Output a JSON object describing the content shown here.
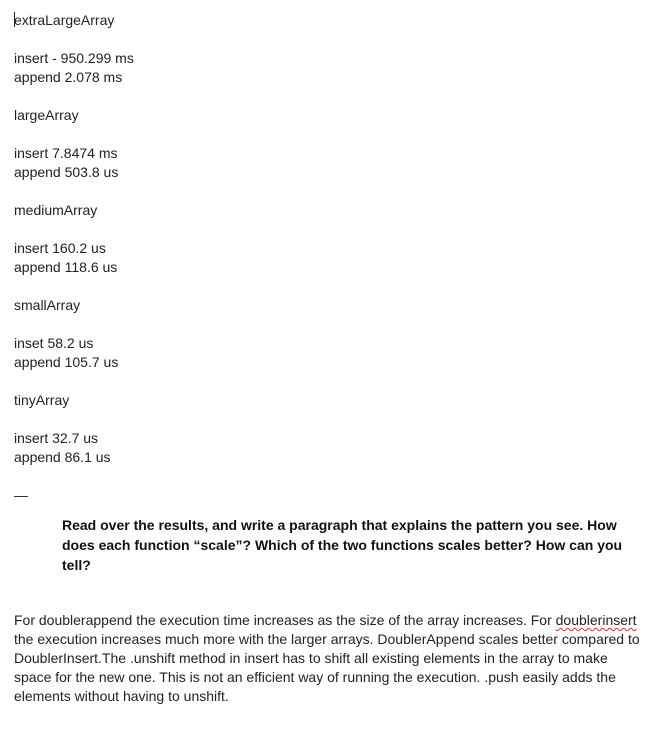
{
  "sections": [
    {
      "name": "extraLargeArray",
      "insert": "insert - 950.299 ms",
      "append": "append 2.078 ms"
    },
    {
      "name": "largeArray",
      "insert": "insert 7.8474 ms",
      "append": "append 503.8 us"
    },
    {
      "name": "mediumArray",
      "insert": "insert 160.2 us",
      "append": "append 118.6 us"
    },
    {
      "name": "smallArray",
      "insert": "inset 58.2 us",
      "append": "append 105.7 us"
    },
    {
      "name": "tinyArray",
      "insert": "insert 32.7 us",
      "append": "append 86.1 us"
    }
  ],
  "separator": "—",
  "question": "Read over the results, and write a paragraph that explains the pattern you see. How does each function “scale”? Which of the two functions scales better? How can you tell?",
  "answer": {
    "part1": "For doublerappend the execution time increases as the size of the array increases. For ",
    "misspelled": "doublerinsert",
    "part2": " the execution increases much more with the larger arrays. DoublerAppend scales better compared to DoublerInsert.The .unshift method in insert has to shift all existing elements in the array to make space for the new one. This is not an efficient way of running the execution. .push easily adds the elements without having to unshift."
  }
}
